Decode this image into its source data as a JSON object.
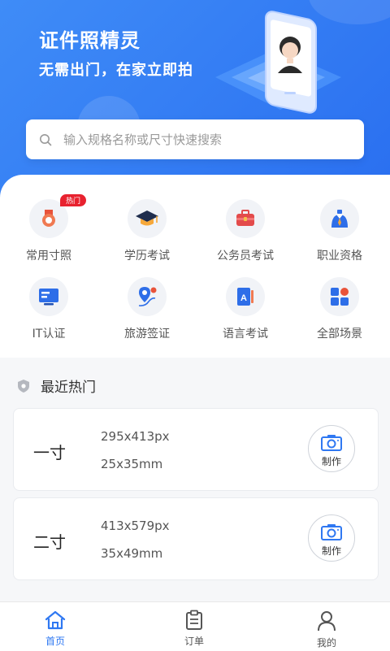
{
  "hero": {
    "title": "证件照精灵",
    "subtitle": "无需出门，在家立即拍"
  },
  "search": {
    "placeholder": "输入规格名称或尺寸快速搜索"
  },
  "categories": [
    {
      "label": "常用寸照",
      "icon": "medal-icon",
      "badge": "热门"
    },
    {
      "label": "学历考试",
      "icon": "graduation-cap-icon"
    },
    {
      "label": "公务员考试",
      "icon": "briefcase-icon"
    },
    {
      "label": "职业资格",
      "icon": "person-tie-icon"
    },
    {
      "label": "IT认证",
      "icon": "monitor-icon"
    },
    {
      "label": "旅游签证",
      "icon": "map-pin-icon"
    },
    {
      "label": "语言考试",
      "icon": "book-a-icon"
    },
    {
      "label": "全部场景",
      "icon": "grid-apps-icon"
    }
  ],
  "recent": {
    "title": "最近热门",
    "items": [
      {
        "name": "一寸",
        "px": "295x413px",
        "mm": "25x35mm",
        "action": "制作"
      },
      {
        "name": "二寸",
        "px": "413x579px",
        "mm": "35x49mm",
        "action": "制作"
      }
    ]
  },
  "tabs": [
    {
      "label": "首页",
      "icon": "home-icon",
      "active": true
    },
    {
      "label": "订单",
      "icon": "clipboard-icon",
      "active": false
    },
    {
      "label": "我的",
      "icon": "user-icon",
      "active": false
    }
  ],
  "colors": {
    "primary": "#2f78f2",
    "hot": "#e8222f",
    "inactive": "#555555"
  }
}
